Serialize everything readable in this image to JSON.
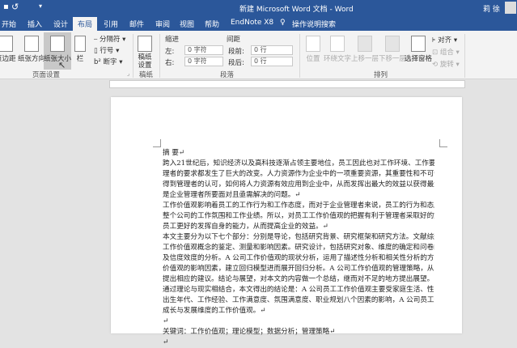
{
  "titlebar": {
    "title": "新建 Microsoft Word 文档 - Word",
    "user": "莉 徐"
  },
  "tabs": [
    "开始",
    "插入",
    "设计",
    "布局",
    "引用",
    "邮件",
    "审阅",
    "视图",
    "帮助",
    "EndNote X8"
  ],
  "tell_me": "操作说明搜索",
  "ribbon": {
    "page_setup": {
      "margins": "页边距",
      "orientation": "纸张方向",
      "size": "纸张大小",
      "columns": "栏",
      "breaks": "分隔符",
      "line_numbers": "行号",
      "hyphenation": "断字",
      "group": "页面设置"
    },
    "manuscript": {
      "button": "稿纸设置",
      "group": "稿纸"
    },
    "paragraph": {
      "indent": "缩进",
      "spacing": "间距",
      "left_label": "左:",
      "left_value": "0 字符",
      "right_label": "右:",
      "right_value": "0 字符",
      "before_label": "段前:",
      "before_value": "0 行",
      "after_label": "段后:",
      "after_value": "0 行",
      "group": "段落"
    },
    "arrange": {
      "position": "位置",
      "wrap": "环绕文字",
      "forward": "上移一层",
      "backward": "下移一层",
      "pane": "选择窗格",
      "align": "对齐",
      "group_btn": "组合",
      "rotate": "旋转",
      "group": "排列"
    }
  },
  "document": {
    "lines": [
      "摘 要↵",
      "跨入21世纪后，知识经济以及高科技逐渐占领主要地位，员工因此也对工作环境、工作要求、管",
      "理者的要求都发生了巨大的改变。人力资源作为企业中的一项重要资源，其重要性和不可替代性已经",
      "得到管理者的认可，如何将人力资源有效应用到企业中，从而发挥出最大的效益以获得最大的利益，",
      "是企业管理者所要面对且亟需解决的问题。↵",
      "工作价值观影响着员工的工作行为和工作态度，而对于企业管理者来说，员工的行为和态度影响着",
      "整个公司的工作氛围和工作业绩。所以，对员工工作价值观的把握有利于管理者采取好的策略帮助",
      "员工更好的发挥自身的能力，从而提高企业的效益。↵",
      "本文主要分为以下七个部分：分别是导论，包括研究背景、研究框架和研究方法。文献综述，包括",
      "工作价值观概念的鉴定、测量和影响因素。研究设计，包括研究对象、维度的确定和问卷的设计以",
      "及信度效度的分析。A 公司工作价值观的现状分析，运用了描述性分析和相关性分析的方法。工作",
      "价值观的影响因素，建立回归模型进而展开回归分析。A 公司工作价值观的管理策略，从问题出发，",
      "提出相应的建议。结论与展望，对本文的内容做一个总结，继而对不足的地方提出展望。↵",
      "通过理论与现实相结合，本文得出的结论是：A 公司员工工作价值观主要受家庭生活、性别、学历、",
      "出生年代、工作经验、工作满意度、氛围满意度、职业规划八个因素的影响，A 公司员工最注重个人",
      "成长与发展维度的工作价值观。↵",
      "↵",
      "关键词：工作价值观；理论模型；数据分析；管理策略↵",
      "↵"
    ]
  }
}
